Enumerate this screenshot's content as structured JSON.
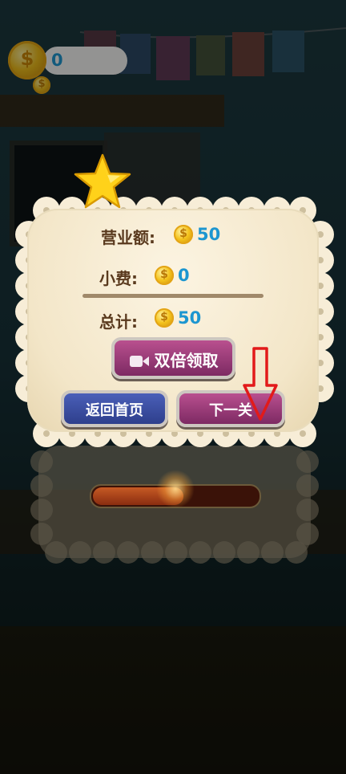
{
  "top_bar": {
    "coin_value": "0",
    "coin_icon": "coin-dollar-icon",
    "coin_symbol": "$"
  },
  "result_panel": {
    "rows": [
      {
        "label": "营业额:",
        "value": "50"
      },
      {
        "label": "小费:",
        "value": "0"
      },
      {
        "label": "总计:",
        "value": "50"
      }
    ],
    "coin_symbol": "$",
    "double_button_label": "双倍领取",
    "double_button_icon": "video-camera-icon",
    "home_button_label": "返回首页",
    "next_button_label": "下一关"
  },
  "progress": {
    "fill_fraction": 0.55
  },
  "colors": {
    "value_blue": "#1c96d0",
    "label_brown": "#5a3a1e",
    "button_purple": "#9a3c7a",
    "button_blue": "#3a4ea2",
    "annotation_red": "#e21a1a"
  }
}
